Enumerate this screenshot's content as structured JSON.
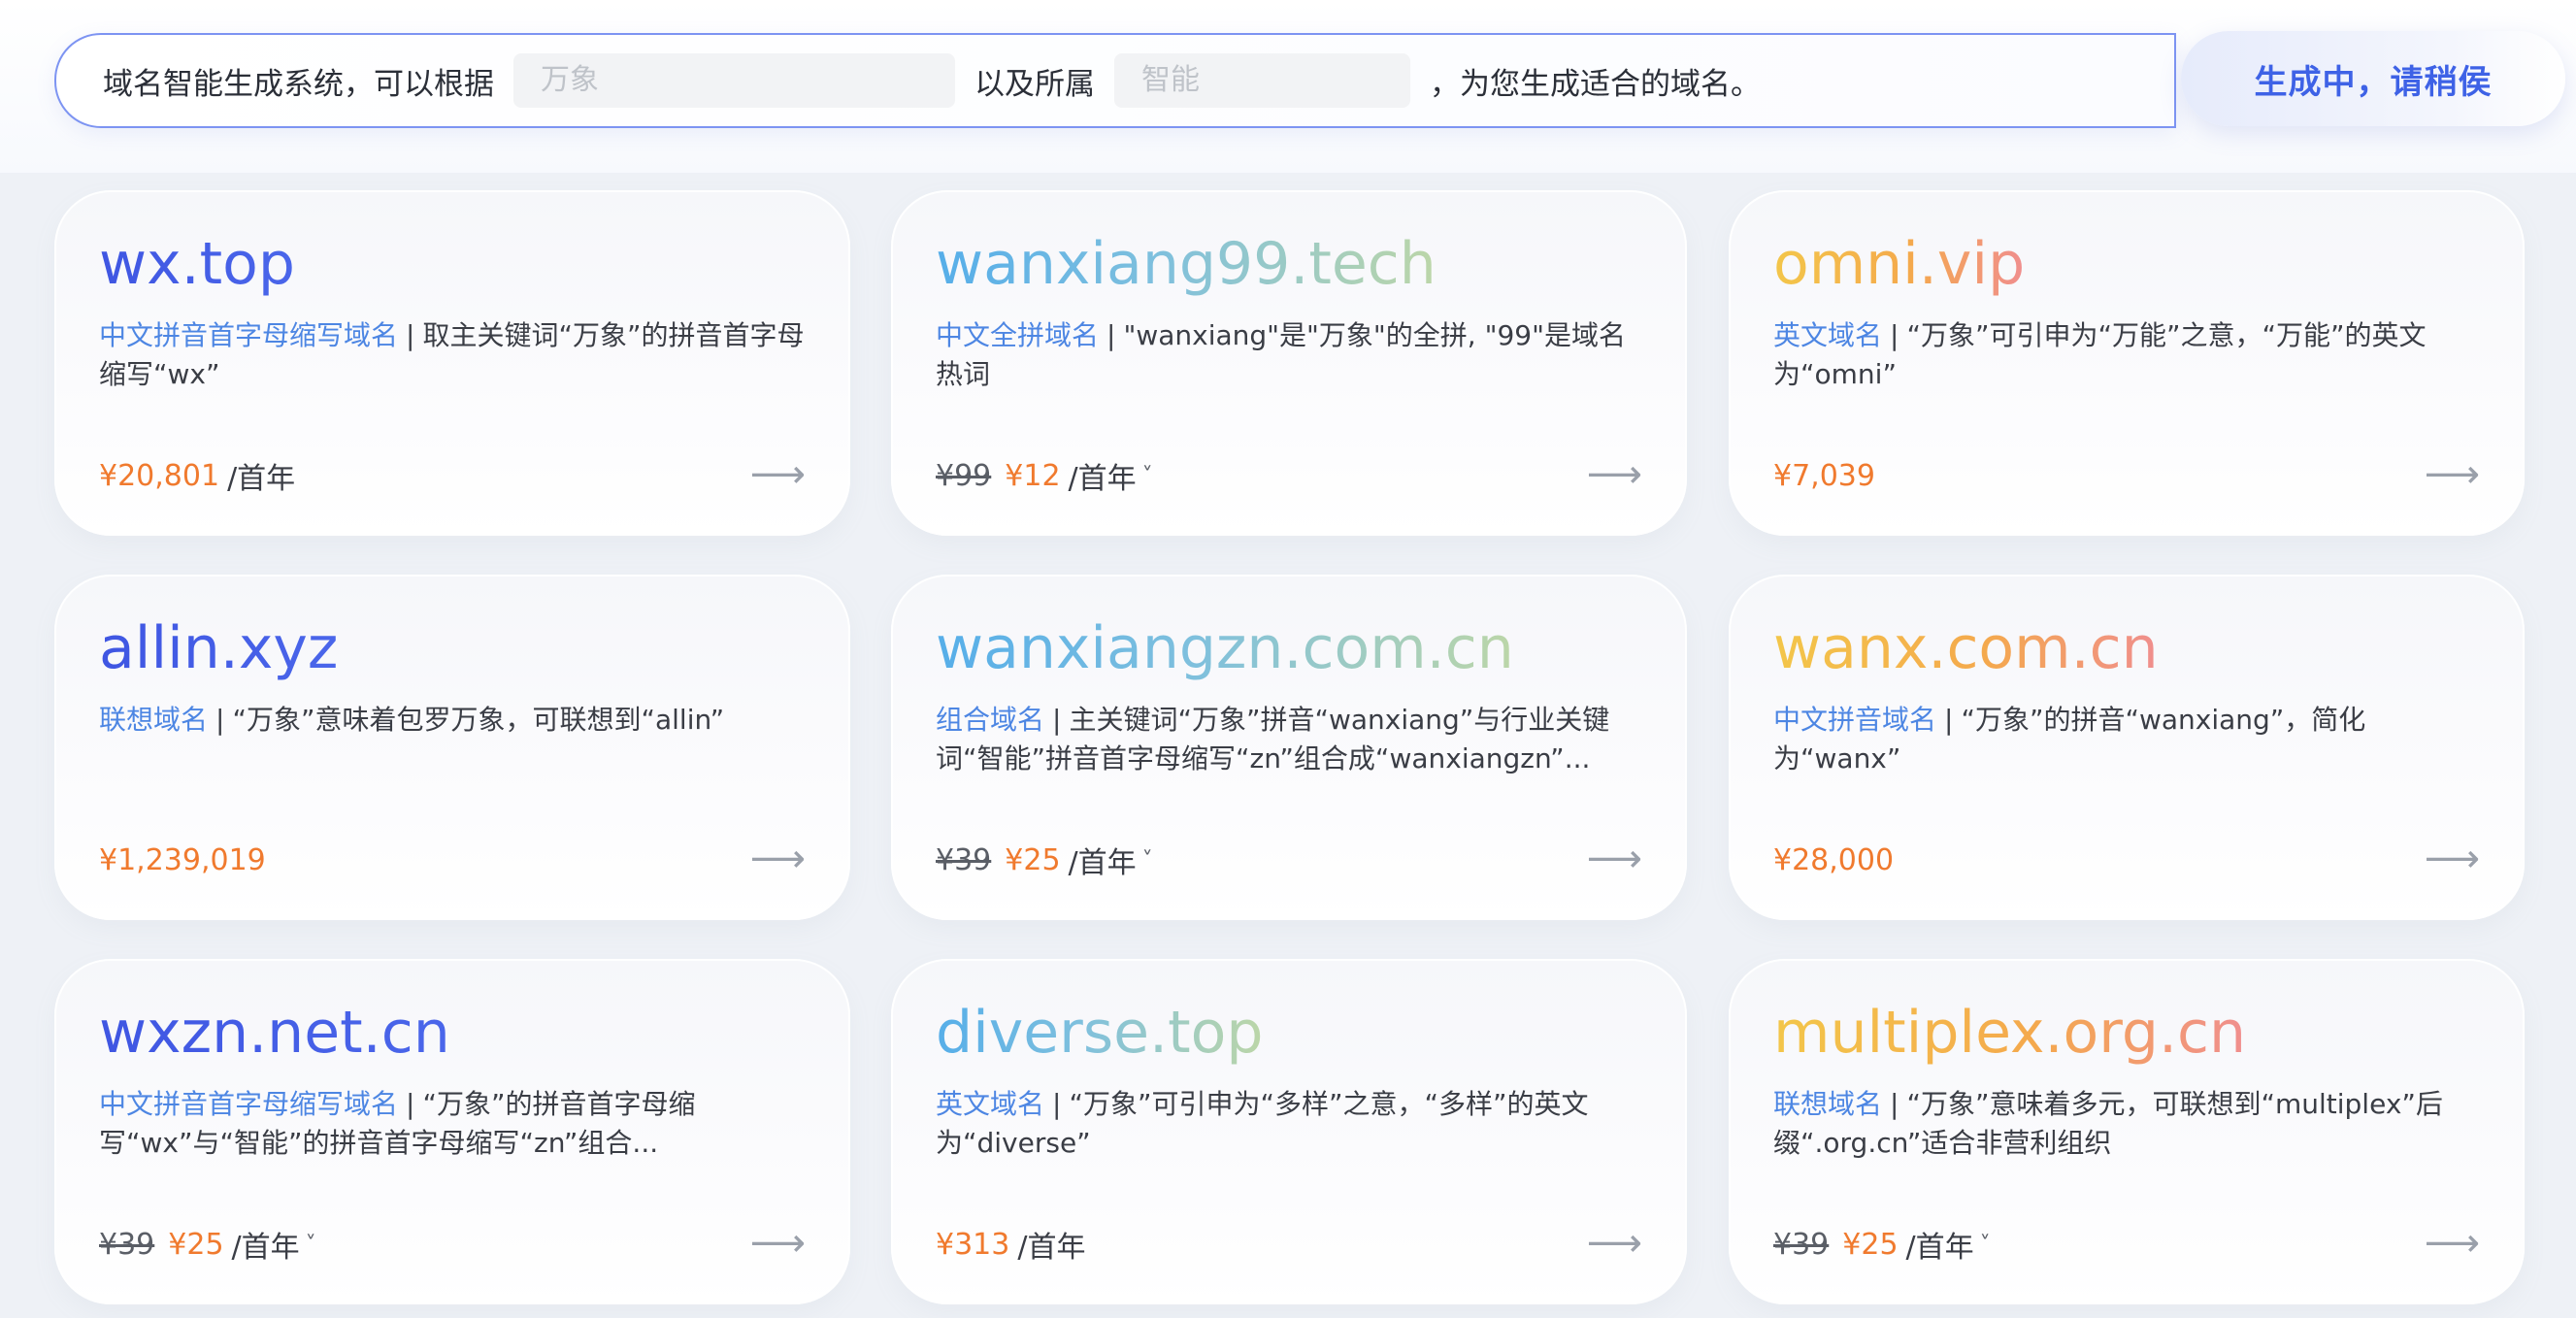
{
  "search": {
    "prefix": "域名智能生成系统，可以根据",
    "keyword_placeholder": "万象",
    "middle": "以及所属",
    "industry_placeholder": "智能",
    "suffix": "，为您生成适合的域名。",
    "button_label": "生成中，请稍侯"
  },
  "cards": [
    {
      "domain": "wx.top",
      "tag": "中文拼音首字母缩写域名",
      "sep": "|",
      "desc": "取主关键词“万象”的拼音首字母缩写“wx”",
      "old_price": "",
      "price": "¥20,801",
      "unit": "/首年",
      "has_dropdown": false,
      "gradient": "blue"
    },
    {
      "domain": "wanxiang99.tech",
      "tag": "中文全拼域名",
      "sep": "|",
      "desc": "\"wanxiang\"是\"万象\"的全拼, \"99\"是域名热词",
      "old_price": "¥99",
      "price": "¥12",
      "unit": "/首年",
      "has_dropdown": true,
      "gradient": "sky"
    },
    {
      "domain": "omni.vip",
      "tag": "英文域名",
      "sep": "|",
      "desc": "“万象”可引申为“万能”之意，“万能”的英文为“omni”",
      "old_price": "",
      "price": "¥7,039",
      "unit": "",
      "has_dropdown": false,
      "gradient": "warm"
    },
    {
      "domain": "allin.xyz",
      "tag": "联想域名",
      "sep": "|",
      "desc": "“万象”意味着包罗万象，可联想到“allin”",
      "old_price": "",
      "price": "¥1,239,019",
      "unit": "",
      "has_dropdown": false,
      "gradient": "blue"
    },
    {
      "domain": "wanxiangzn.com.cn",
      "tag": "组合域名",
      "sep": "|",
      "desc": "主关键词“万象”拼音“wanxiang”与行业关键词“智能”拼音首字母缩写“zn”组合成“wanxiangzn”...",
      "old_price": "¥39",
      "price": "¥25",
      "unit": "/首年",
      "has_dropdown": true,
      "gradient": "sky"
    },
    {
      "domain": "wanx.com.cn",
      "tag": "中文拼音域名",
      "sep": "|",
      "desc": "“万象”的拼音“wanxiang”，简化为“wanx”",
      "old_price": "",
      "price": "¥28,000",
      "unit": "",
      "has_dropdown": false,
      "gradient": "warm"
    },
    {
      "domain": "wxzn.net.cn",
      "tag": "中文拼音首字母缩写域名",
      "sep": "|",
      "desc": "“万象”的拼音首字母缩写“wx”与“智能”的拼音首字母缩写“zn”组合...",
      "old_price": "¥39",
      "price": "¥25",
      "unit": "/首年",
      "has_dropdown": true,
      "gradient": "blue"
    },
    {
      "domain": "diverse.top",
      "tag": "英文域名",
      "sep": "|",
      "desc": "“万象”可引申为“多样”之意，“多样”的英文为“diverse”",
      "old_price": "",
      "price": "¥313",
      "unit": "/首年",
      "has_dropdown": false,
      "gradient": "sky"
    },
    {
      "domain": "multiplex.org.cn",
      "tag": "联想域名",
      "sep": "|",
      "desc": "“万象”意味着多元，可联想到“multiplex”后缀“.org.cn”适合非营利组织",
      "old_price": "¥39",
      "price": "¥25",
      "unit": "/首年",
      "has_dropdown": true,
      "gradient": "warm"
    }
  ],
  "icons": {
    "arrow": "arrow-right-icon",
    "dropdown": "chevron-down-icon"
  },
  "colors": {
    "accent_blue": "#3e62e6",
    "price_orange": "#f07a2e",
    "tag_blue": "#4d86e3"
  }
}
